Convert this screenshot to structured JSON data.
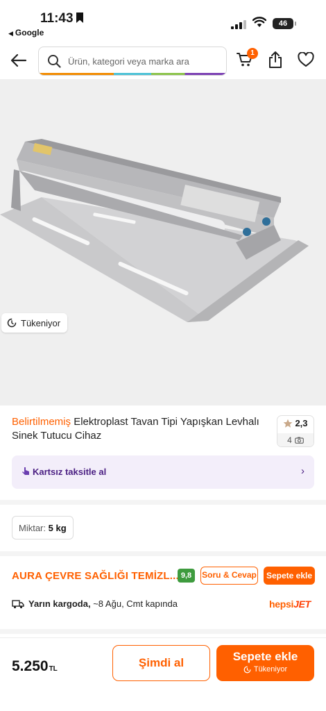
{
  "status_bar": {
    "time": "11:43",
    "back_app": "Google",
    "battery": "46"
  },
  "header": {
    "search_placeholder": "Ürün, kategori veya marka ara",
    "cart_count": "1"
  },
  "product": {
    "stock_label": "Tükeniyor",
    "brand": "Belirtilmemiş",
    "name": "Elektroplast Tavan Tipi Yapışkan Levhalı Sinek Tutucu Cihaz",
    "rating": "2,3",
    "review_photo_count": "4"
  },
  "installment": {
    "label": "Kartsız taksitle al"
  },
  "quantity": {
    "label": "Miktar:",
    "value": "5 kg"
  },
  "seller": {
    "name": "AURA ÇEVRE SAĞLIĞI TEMİZL...",
    "score": "9,8",
    "qa_label": "Soru & Cevap",
    "add_to_cart_label": "Sepete ekle"
  },
  "delivery": {
    "bold": "Yarın kargoda,",
    "rest": "~8 Ağu, Cmt kapında",
    "carrier_prefix": "hepsi",
    "carrier_suffix": "JET"
  },
  "bottom_bar": {
    "price": "5.250",
    "currency": "TL",
    "buy_now_label": "Şimdi al",
    "add_to_cart_label": "Sepete ekle",
    "add_to_cart_sub": "Tükeniyor"
  },
  "colors": {
    "accent": "#ff6000",
    "purple": "#4a1e82",
    "score_green": "#3e9b3e"
  }
}
